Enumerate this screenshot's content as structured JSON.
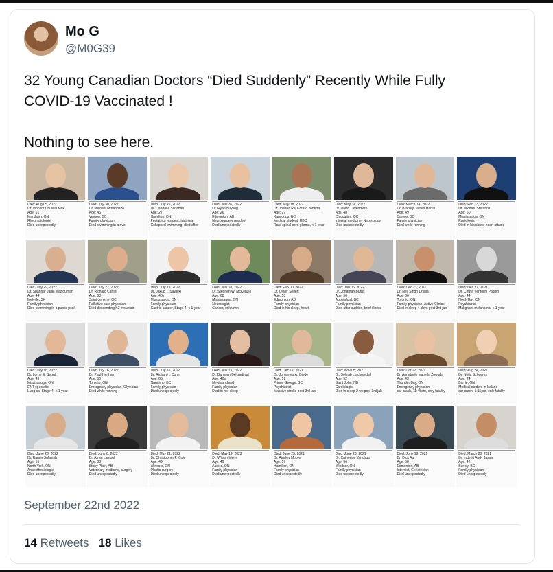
{
  "tweet": {
    "name": "Mo G",
    "handle": "@M0G39",
    "text": "32 Young Canadian Doctors “Died Suddenly” Recently While Fully\nCOVID-19 Vaccinated !\n\nNothing to see here.",
    "date": "September 22nd 2022",
    "retweets_count": "14",
    "retweets_label": "Retweets",
    "likes_count": "18",
    "likes_label": "Likes"
  },
  "doctors": [
    {
      "d": "Died: Aug 05, 2022",
      "n": "Dr. Vincent Chi Wai Mak",
      "a": "Age: 61",
      "l": "Markham, ON",
      "s": "Rheumatologist",
      "c": "Died unexpectedly",
      "bg": "#c9b6a0",
      "skin": "#e6c3a3",
      "shirt": "#222"
    },
    {
      "d": "Died: July 30, 2022",
      "n": "Dr. Michael Mthandazo",
      "a": "Age: 46",
      "l": "Vernon, BC",
      "s": "Family physician",
      "c": "Died swimming in a river",
      "bg": "#8fa4c0",
      "skin": "#5a3b27",
      "shirt": "#2a4f8f"
    },
    {
      "d": "Died: July 26, 2022",
      "n": "Dr. Candace Yeryman",
      "a": "Age: 27",
      "l": "Hamilton, ON",
      "s": "Pediatrics resident, triathlete",
      "c": "Collapsed swimming, died after",
      "bg": "#d8d4cf",
      "skin": "#eac9ad",
      "shirt": "#3a2a22"
    },
    {
      "d": "Died: July 26, 2022",
      "n": "Dr. Ryan Buyting",
      "a": "Age: 26",
      "l": "Edmonton, AB",
      "s": "Neurosurgery resident",
      "c": "Died unexpectedly",
      "bg": "#c8d3dc",
      "skin": "#e8c1a0",
      "shirt": "#1f2c3a"
    },
    {
      "d": "Died: May 18, 2022",
      "n": "Dr. Joshua Raj Kotaro Yoneda",
      "a": "Age: 27",
      "l": "Kamloops, BC",
      "s": "Medical student, UBC",
      "c": "Rare spinal cord glioma, < 1 year",
      "bg": "#7c8e6b",
      "skin": "#a87454",
      "shirt": "#eeeeee"
    },
    {
      "d": "Died: May 14, 2022",
      "n": "Dr. David Lavendiere",
      "a": "Age: 48",
      "l": "Chicoutimi, QC",
      "s": "Internal medicine, Nephrology",
      "c": "Died unexpectedly",
      "bg": "#2c2c2c",
      "skin": "#dfb899",
      "shirt": "#1a1a1a"
    },
    {
      "d": "Died: March 14, 2022",
      "n": "Dr. Bradley James Harris",
      "a": "Age: 49",
      "l": "Camox, BC",
      "s": "Family physician",
      "c": "Died while running",
      "bg": "#bcc6cc",
      "skin": "#e0b897",
      "shirt": "#6b6b6b"
    },
    {
      "d": "Died: Feb 13, 2022",
      "n": "Dr. Michael Stefanos",
      "a": "Age: 50",
      "l": "Mississauga, ON",
      "s": "Radiologist",
      "c": "Died in his sleep, heart attack",
      "bg": "#1e3f73",
      "skin": "#d9ae8b",
      "shirt": "#111"
    },
    {
      "d": "Died: July 29, 2022",
      "n": "Dr. Shahriar Jalali Mazlouman",
      "a": "Age: 44",
      "l": "Melville, SK",
      "s": "Family physician",
      "c": "Died swimming in a public pool",
      "bg": "#ddd8d2",
      "skin": "#d8b08f",
      "shirt": "#243554"
    },
    {
      "d": "Died: July 22, 2022",
      "n": "Dr. Richard Cartier",
      "a": "Age: 68",
      "l": "Saint-Jerome, QC",
      "s": "Palliative care physician",
      "c": "Died descending K2 mountain",
      "bg": "#a0a08a",
      "skin": "#dcae8d",
      "shirt": "#777"
    },
    {
      "d": "Died: July 19, 2022",
      "n": "Dr. Jakub T. Sawicki",
      "a": "Age: 40s",
      "l": "Mississauga, ON",
      "s": "Family physician",
      "c": "Gastric cancer, Stage 4, < 1 year",
      "bg": "#f1f1f1",
      "skin": "#ecc6a6",
      "shirt": "#2c2c2c"
    },
    {
      "d": "Died: July 18, 2022",
      "n": "Dr. Stephen W. McKenzie",
      "a": "Age: 68",
      "l": "Mississauga, ON",
      "s": "Neurologist",
      "c": "Cancer, unknown",
      "bg": "#6f8a5a",
      "skin": "#e3b999",
      "shirt": "#1e2d4f"
    },
    {
      "d": "Died: Feb 00, 2022",
      "n": "Dr. Oliver Seifert",
      "a": "Age: 53",
      "l": "Edmonton, AB",
      "s": "Family physician",
      "c": "Died in his sleep, heart",
      "bg": "#8c7a66",
      "skin": "#d7ab87",
      "shirt": "#503a2a"
    },
    {
      "d": "Died: Jan 06, 2022",
      "n": "Dr. Jonathan Burns",
      "a": "Age: 56",
      "l": "Abbotsford, BC",
      "s": "Family physician",
      "c": "Died after sudden, brief illness",
      "bg": "#b7b7b7",
      "skin": "#e1b896",
      "shirt": "#445"
    },
    {
      "d": "Died: Dec 23, 2021",
      "n": "Dr. Neil Singh Dhalla",
      "a": "Age: 66",
      "l": "Toronto, ON",
      "s": "Family physician, Active Clinics",
      "c": "Died in sleep 4 days post 3rd jab",
      "bg": "#c0b7ab",
      "skin": "#c8916b",
      "shirt": "#111"
    },
    {
      "d": "Died: Dec 21, 2021",
      "n": "Dr. Cinzia Ventolini Padoin",
      "a": "Age: 44",
      "l": "North Bay, ON",
      "s": "Psychiatrist",
      "c": "Malignant melanoma, < 1 year",
      "bg": "#9a9a9a",
      "skin": "#d8d8d8",
      "shirt": "#333"
    },
    {
      "d": "Died: July 16, 2022",
      "n": "Dr. Lorne E. Segall",
      "a": "Age: 49",
      "l": "Mississauga, ON",
      "s": "ENT specialist",
      "c": "Lung ca, Stage 4, < 1 year",
      "bg": "#dcdcdc",
      "skin": "#e2b898",
      "shirt": "#1b2436"
    },
    {
      "d": "Died: July 16, 2022",
      "n": "Dr. Paul Henham",
      "a": "Age: 50",
      "l": "Toronto, ON",
      "s": "Emergency physician, Olympian",
      "c": "Died while running",
      "bg": "#e9e9e9",
      "skin": "#dfb696",
      "shirt": "#3d4d63"
    },
    {
      "d": "Died: July 15, 2022",
      "n": "Dr. Richard L Cone",
      "a": "Age: 66",
      "l": "Nanaimo, BC",
      "s": "Family physician",
      "c": "Died unexpectedly",
      "bg": "#2d6fb5",
      "skin": "#e2b189",
      "shirt": "#e5e5e5"
    },
    {
      "d": "Died: July 13, 2022",
      "n": "Dr. Baharen Behzadirad",
      "a": "Age: 40s",
      "l": "Newfoundland",
      "s": "Family physician",
      "c": "Died in her sleep",
      "bg": "#3c3c3c",
      "skin": "#e4bea0",
      "shirt": "#2a1a1a"
    },
    {
      "d": "Died: Dec 17, 2021",
      "n": "Dr. Johannes A. Giede",
      "a": "Age: 59",
      "l": "Prince George, BC",
      "s": "Psychiatrist",
      "c": "Massive stroke post 3rd jab",
      "bg": "#a7b48a",
      "skin": "#e0b99a",
      "shirt": "#dcdcdc"
    },
    {
      "d": "Died: Nov 08, 2021",
      "n": "Dr. Sohrab Lutchmedial",
      "a": "Age: 52",
      "l": "Saint John, NB",
      "s": "Cardiologist",
      "c": "Died in sleep 2 wk post 3rd jab",
      "bg": "#eeeeee",
      "skin": "#8a5c3f",
      "shirt": "#f4f4f4"
    },
    {
      "d": "Died: Oct 22, 2021",
      "n": "Dr. Annabelle Isabella Zowada",
      "a": "Age: 43",
      "l": "Thunder Bay, ON",
      "s": "Emergency physician",
      "c": "car crash, 11:45am, only fatality",
      "bg": "#d9c3a6",
      "skin": "#e8c2a2",
      "shirt": "#6b4a2e"
    },
    {
      "d": "Died: Aug 24, 2021",
      "n": "Dr. Nella Scheeres",
      "a": "Age: 24",
      "l": "Barrie, ON",
      "s": "Medical student in Ireland",
      "c": "car crash, 1:15pm, only fatality",
      "bg": "#c9a574",
      "skin": "#f0cfb2",
      "shirt": "#8a6d52"
    },
    {
      "d": "Died: June 20, 2022",
      "n": "Dr. Ramin Safakish",
      "a": "Age: 55",
      "l": "North York, ON",
      "s": "Anaesthesiologist",
      "c": "Died unexpectedly",
      "bg": "#c6cfd6",
      "skin": "#d9ac88",
      "shirt": "#e6e6e6"
    },
    {
      "d": "Died: June 6, 2022",
      "n": "Dr. Arran Lamont",
      "a": "Age: 38",
      "l": "Stony Plain, AB",
      "s": "Veterinary medicine, surgery",
      "c": "Died unexpectedly",
      "bg": "#3b3b3b",
      "skin": "#d9a982",
      "shirt": "#222"
    },
    {
      "d": "Died: May 21, 2022",
      "n": "Dr. Christopher P. Cole",
      "a": "Age: 49",
      "l": "Windsor, ON",
      "s": "Plastic surgery",
      "c": "Died unexpectedly",
      "bg": "#b9b9b9",
      "skin": "#e4bb9a",
      "shirt": "#f2f2f2"
    },
    {
      "d": "Died: May 19, 2022",
      "n": "Dr. Wilson Idemi",
      "a": "Age: 49",
      "l": "Aurora, ON",
      "s": "Family physician",
      "c": "Died unexpectedly",
      "bg": "#c98a3a",
      "skin": "#5b3a24",
      "shirt": "#e9e2c8"
    },
    {
      "d": "Died: June 25, 2021",
      "n": "Dr. Ainsley Moore",
      "a": "Age: 57",
      "l": "Hamilton, ON",
      "s": "Family physician",
      "c": "Died unexpectedly",
      "bg": "#4a6a8c",
      "skin": "#eec6a4",
      "shirt": "#b46a3c"
    },
    {
      "d": "Died: June 20, 2021",
      "n": "Dr. Catherine Yanchula",
      "a": "Age: 56",
      "l": "Windsor, ON",
      "s": "Family physician",
      "c": "Died unexpectedly",
      "bg": "#8aa2ba",
      "skin": "#f0caa8",
      "shirt": "#f1f1f1"
    },
    {
      "d": "Died: June 19, 2021",
      "n": "Dr. Dick Au",
      "a": "Age: 58",
      "l": "Edmonton, AB",
      "s": "Internist, Geriatrician",
      "c": "Died unexpectedly",
      "bg": "#394a55",
      "skin": "#d9ab86",
      "shirt": "#1e1e1e"
    },
    {
      "d": "Died: March 20, 2021",
      "n": "Dr. Inderjit Andy Jassal",
      "a": "Age: 42",
      "l": "Surrey, BC",
      "s": "Family physician",
      "c": "Died unexpectedly",
      "bg": "#d7d3cd",
      "skin": "#c58d66",
      "shirt": "#ddd"
    }
  ]
}
